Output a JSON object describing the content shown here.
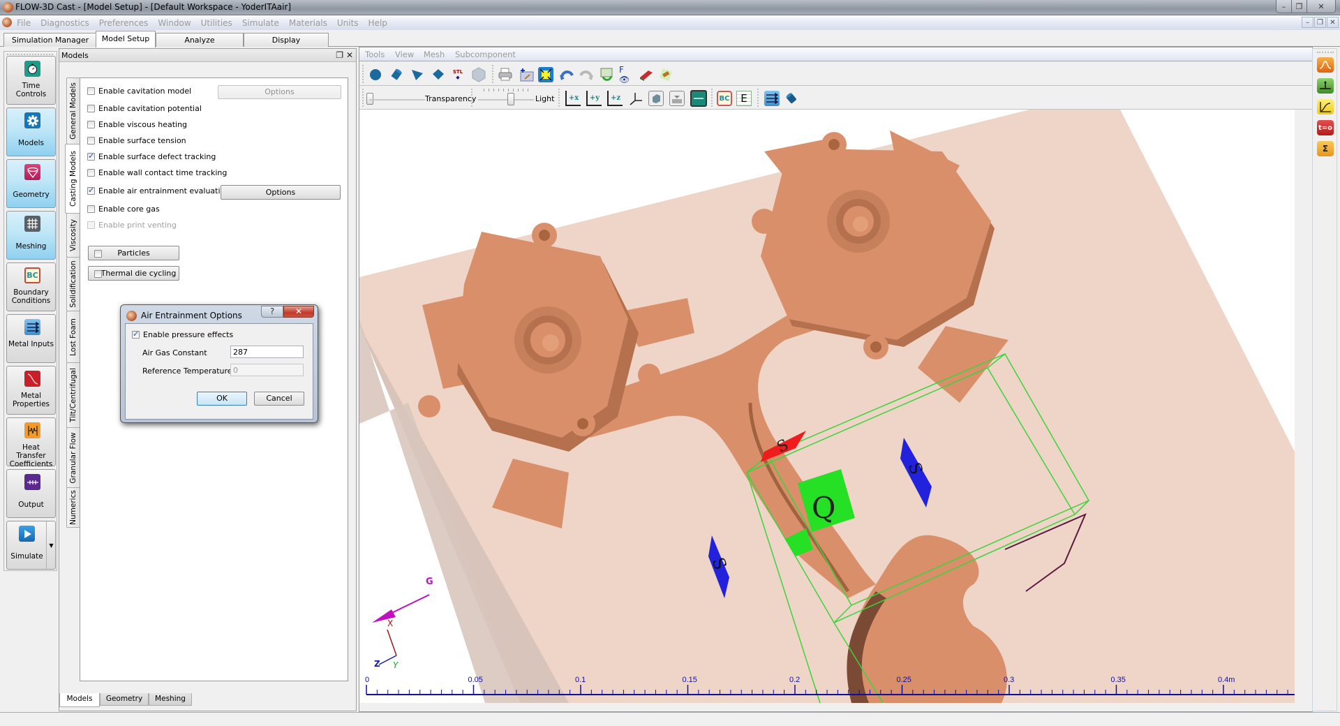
{
  "window": {
    "title": "FLOW-3D Cast - [Model Setup] - [Default Workspace - YoderITAair]",
    "controls": {
      "minimize": "–",
      "restore": "❐",
      "close": "✕"
    }
  },
  "menubar": {
    "items": [
      "File",
      "Diagnostics",
      "Preferences",
      "Window",
      "Utilities",
      "Simulate",
      "Materials",
      "Units",
      "Help"
    ],
    "mdi_controls": {
      "minimize": "–",
      "restore": "❐",
      "close": "✕"
    }
  },
  "main_tabs": [
    {
      "label": "Simulation Manager",
      "active": false
    },
    {
      "label": "Model Setup",
      "active": true
    },
    {
      "label": "Analyze",
      "active": false
    },
    {
      "label": "Display",
      "active": false
    }
  ],
  "left_toolbar": [
    {
      "label": "Time Controls",
      "icon": "stopwatch-icon",
      "active": false
    },
    {
      "label": "Models",
      "icon": "gear-icon",
      "active": true
    },
    {
      "label": "Geometry",
      "icon": "geometry-icon",
      "active": true
    },
    {
      "label": "Meshing",
      "icon": "mesh-grid-icon",
      "active": true
    },
    {
      "label": "Boundary Conditions",
      "icon": "bc-icon",
      "icon_text": "BC",
      "active": false
    },
    {
      "label": "Metal Inputs",
      "icon": "metal-inputs-icon",
      "active": false
    },
    {
      "label": "Metal Properties",
      "icon": "metal-properties-icon",
      "active": false
    },
    {
      "label": "Heat Transfer Coefficients",
      "icon": "heat-transfer-icon",
      "active": false
    },
    {
      "label": "Output",
      "icon": "output-icon",
      "active": false
    },
    {
      "label": "Simulate",
      "icon": "play-icon",
      "active": false
    }
  ],
  "models_panel": {
    "title": "Models",
    "vertical_tabs": [
      {
        "label": "General Models",
        "active": false
      },
      {
        "label": "Casting Models",
        "active": true
      },
      {
        "label": "Viscosity",
        "active": false
      },
      {
        "label": "Solidification",
        "active": false
      },
      {
        "label": "Lost Foam",
        "active": false
      },
      {
        "label": "Tilt/Centrifugal",
        "active": false
      },
      {
        "label": "Granular Flow",
        "active": false
      },
      {
        "label": "Numerics",
        "active": false
      }
    ],
    "options": [
      {
        "label": "Enable cavitation model",
        "checked": false,
        "disabled": false
      },
      {
        "label": "Enable cavitation potential",
        "checked": false,
        "disabled": false
      },
      {
        "label": "Enable viscous heating",
        "checked": false,
        "disabled": false
      },
      {
        "label": "Enable surface tension",
        "checked": false,
        "disabled": false
      },
      {
        "label": "Enable surface defect tracking",
        "checked": true,
        "disabled": false
      },
      {
        "label": "Enable wall contact time tracking",
        "checked": false,
        "disabled": false
      },
      {
        "label": "Enable air entrainment evaluation",
        "checked": true,
        "disabled": false
      },
      {
        "label": "Enable core gas",
        "checked": false,
        "disabled": false
      },
      {
        "label": "Enable print venting",
        "checked": false,
        "disabled": true
      }
    ],
    "cavitation_options_button": "Options",
    "air_entrainment_options_button": "Options",
    "group_buttons": [
      {
        "label": "Particles",
        "checked": false
      },
      {
        "label": "Thermal die cycling",
        "checked": false
      }
    ],
    "bottom_tabs": [
      {
        "label": "Models",
        "active": true
      },
      {
        "label": "Geometry",
        "active": false
      },
      {
        "label": "Meshing",
        "active": false
      }
    ]
  },
  "dialog": {
    "title": "Air Entrainment Options",
    "help_button": "?",
    "close_button": "✕",
    "enable_pressure_effects": {
      "label": "Enable pressure effects",
      "checked": true
    },
    "air_gas_constant": {
      "label": "Air Gas Constant",
      "value": "287"
    },
    "reference_temperature": {
      "label": "Reference Temperature",
      "value": "0",
      "disabled": true
    },
    "ok": "OK",
    "cancel": "Cancel"
  },
  "view": {
    "menu": [
      "Tools",
      "View",
      "Mesh",
      "Subcomponent"
    ],
    "toolbar1": [
      "sphere-icon",
      "cylinder-icon",
      "cone-icon",
      "box-icon",
      "stl-import-icon",
      "mesh-block-icon",
      "print-icon",
      "add-baffle-icon",
      "fit-view-icon",
      "undo-icon",
      "redo-icon",
      "reload-icon",
      "visibility-icon",
      "component-icon",
      "subcomponent-icon"
    ],
    "stl_label": "STL",
    "transparency_label": "Transparency",
    "transparency_value": 0,
    "light_label": "Light",
    "light_value": 0.55,
    "toolbar2": [
      {
        "icon": "view-plus-x-icon",
        "text": "+x"
      },
      {
        "icon": "view-plus-y-icon",
        "text": "+y"
      },
      {
        "icon": "view-plus-z-icon",
        "text": "+z"
      },
      {
        "icon": "axes-icon",
        "text": ""
      },
      {
        "icon": "solid-view-icon",
        "text": ""
      },
      {
        "icon": "fluid-level-icon",
        "text": ""
      },
      {
        "icon": "fluid-region-icon",
        "text": ""
      },
      {
        "icon": "boundary-conditions-icon",
        "text": "BC"
      },
      {
        "icon": "edit-table-icon",
        "text": "E"
      },
      {
        "icon": "metal-input-icon",
        "text": ""
      },
      {
        "icon": "cylinder-component-icon",
        "text": ""
      }
    ],
    "gravity_label": "G",
    "axis_labels": {
      "x": "X",
      "y": "Y",
      "z": "Z"
    },
    "ruler": {
      "ticks": [
        "0",
        "0.05",
        "0.1",
        "0.15",
        "0.2",
        "0.25",
        "0.3",
        "0.35",
        "0.4m"
      ],
      "colors": {
        "ruler": "#10109a",
        "mesh_box": "#3bd43b",
        "casting": "#d98f6a",
        "mold": "#efd5c8",
        "gravity": "#c010c0"
      }
    },
    "boundary_markers": [
      {
        "label": "S",
        "color": "#2222dd",
        "position": "x-min"
      },
      {
        "label": "S",
        "color": "#2222dd",
        "position": "x-max"
      },
      {
        "label": "S",
        "color": "#ee1c1c",
        "position": "y-max"
      },
      {
        "label": "Q",
        "color": "#25e025",
        "position": "z-min"
      }
    ]
  },
  "right_toolbar": [
    {
      "icon": "probe-signal-icon",
      "color": "#f07a1a"
    },
    {
      "icon": "pressure-point-icon",
      "color": "#4fa83a"
    },
    {
      "icon": "history-graph-icon",
      "color": "#f2d421"
    },
    {
      "icon": "initial-conditions-icon",
      "text": "t=o",
      "color": "#d02a2a"
    },
    {
      "icon": "sum-volume-icon",
      "text": "Σ",
      "color": "#f2a531"
    }
  ]
}
